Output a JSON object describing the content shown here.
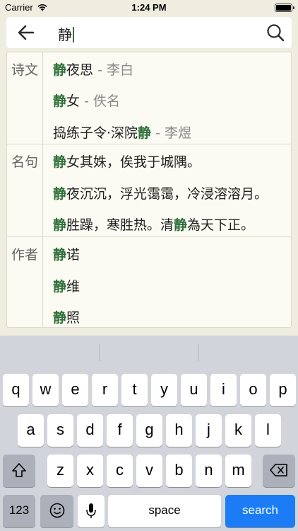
{
  "status_bar": {
    "carrier": "Carrier",
    "time": "1:24 PM",
    "battery_level": 1.0
  },
  "search": {
    "value": "静"
  },
  "results": {
    "sections": [
      {
        "label": "诗文",
        "rows": [
          {
            "before": "",
            "highlight": "静",
            "after": "夜思",
            "suffix": " - 李白"
          },
          {
            "before": "",
            "highlight": "静",
            "after": "女",
            "suffix": " - 佚名"
          },
          {
            "before": "捣练子令·深院",
            "highlight": "静",
            "after": "",
            "suffix": " - 李煜"
          }
        ]
      },
      {
        "label": "名句",
        "rows": [
          {
            "before": "",
            "highlight": "静",
            "after": "女其姝，俟我于城隅。",
            "suffix": ""
          },
          {
            "before": "",
            "highlight": "静",
            "after": "夜沉沉，浮光霭霭，冷浸溶溶月。",
            "suffix": ""
          },
          {
            "before": "",
            "highlight": "静",
            "after": "胜躁，寒胜热。清",
            "suffix": "",
            "highlight2": "静",
            "after2": "為天下正。"
          }
        ]
      },
      {
        "label": "作者",
        "rows": [
          {
            "before": "",
            "highlight": "静",
            "after": "诺",
            "suffix": ""
          },
          {
            "before": "",
            "highlight": "静",
            "after": "维",
            "suffix": ""
          },
          {
            "before": "",
            "highlight": "静",
            "after": "照",
            "suffix": ""
          }
        ]
      }
    ]
  },
  "keyboard": {
    "row1": [
      "q",
      "w",
      "e",
      "r",
      "t",
      "y",
      "u",
      "i",
      "o",
      "p"
    ],
    "row2": [
      "a",
      "s",
      "d",
      "f",
      "g",
      "h",
      "j",
      "k",
      "l"
    ],
    "row3": [
      "z",
      "x",
      "c",
      "v",
      "b",
      "n",
      "m"
    ],
    "numbers_label": "123",
    "space_label": "space",
    "search_label": "search",
    "shift_icon": "shift-icon",
    "delete_icon": "delete-icon",
    "emoji_icon": "emoji-icon",
    "mic_icon": "microphone-icon"
  },
  "colors": {
    "accent": "#2f6f3a",
    "search_key": "#1b7cf5",
    "background": "#eeeddf"
  }
}
